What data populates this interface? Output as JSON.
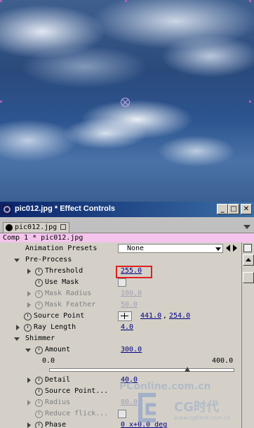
{
  "window": {
    "title": "pic012.jpg * Effect Controls",
    "min_glyph": "_",
    "max_glyph": "□",
    "close_glyph": "✕"
  },
  "tab": {
    "label": "pic012.jpg"
  },
  "comp_label": "Comp 1 * pic012.jpg",
  "animation_presets": {
    "label": "Animation Presets",
    "value": "None"
  },
  "groups": {
    "preprocess": "Pre-Process",
    "shimmer": "Shimmer"
  },
  "props": {
    "threshold": {
      "label": "Threshold",
      "value": "255.0"
    },
    "use_mask": {
      "label": "Use Mask"
    },
    "mask_radius": {
      "label": "Mask Radius",
      "value": "100.0"
    },
    "mask_feather": {
      "label": "Mask Feather",
      "value": "50.0"
    },
    "source_point": {
      "label": "Source Point",
      "x": "441.0",
      "sep": ",",
      "y": "254.0"
    },
    "ray_length": {
      "label": "Ray Length",
      "value": "4.0"
    },
    "amount": {
      "label": "Amount",
      "value": "300.0",
      "slider_min": "0.0",
      "slider_max": "400.0",
      "slider_fraction": 0.75
    },
    "detail": {
      "label": "Detail",
      "value": "40.0"
    },
    "source_point2": {
      "label": "Source Point..."
    },
    "radius": {
      "label": "Radius",
      "value": "80.0"
    },
    "reduce_flicker": {
      "label": "Reduce flick..."
    },
    "phase": {
      "label": "Phase",
      "value": "0 x+0.0 deg"
    }
  },
  "watermark": {
    "site": "PConline.com.cn",
    "brand": "CG时代",
    "url": "www.cgtime.com.cn"
  },
  "colors": {
    "title_start": "#0a246a",
    "title_end": "#3a6ea5",
    "comp_label_bg": "#f4c4ec",
    "highlight": "#e02020",
    "value_link": "#000080"
  }
}
